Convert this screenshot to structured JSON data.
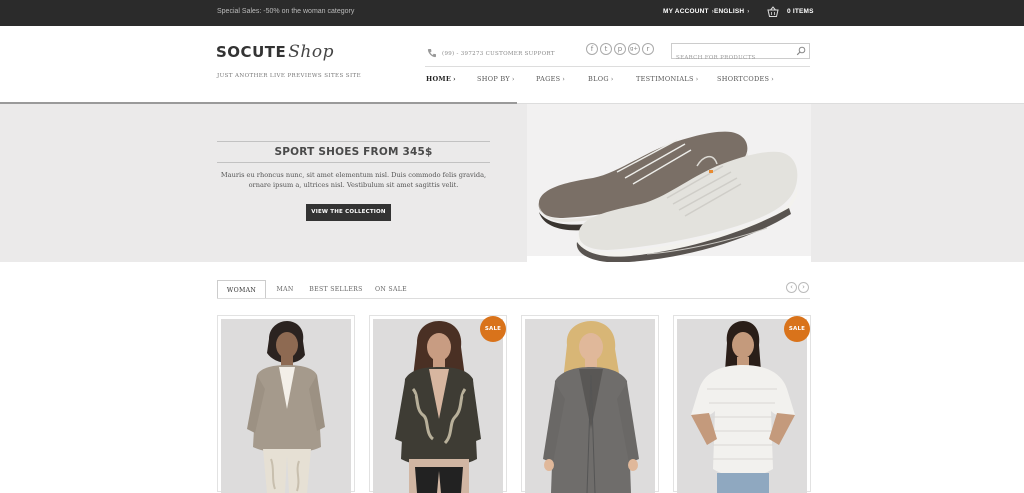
{
  "topbar": {
    "promo": "Special Sales: -50% on the woman category",
    "my_account": "MY ACCOUNT",
    "language": "ENGLISH",
    "cart_count": "0 ITEMS",
    "cart_icon": "shopping-basket-icon"
  },
  "header": {
    "logo_main": "SOCUTE",
    "logo_script": "Shop",
    "tagline": "JUST ANOTHER LIVE PREVIEWS SITES SITE",
    "phone": "(99) - 397273 CUSTOMER SUPPORT",
    "social": [
      {
        "icon": "facebook-icon",
        "glyph": "f"
      },
      {
        "icon": "twitter-icon",
        "glyph": "t"
      },
      {
        "icon": "pinterest-icon",
        "glyph": "p"
      },
      {
        "icon": "google-plus-icon",
        "glyph": "g+"
      },
      {
        "icon": "rss-icon",
        "glyph": "r"
      }
    ],
    "search_placeholder": "SEARCH FOR PRODUCTS"
  },
  "nav": [
    {
      "label": "HOME",
      "active": true
    },
    {
      "label": "SHOP BY",
      "active": false
    },
    {
      "label": "PAGES",
      "active": false
    },
    {
      "label": "BLOG",
      "active": false
    },
    {
      "label": "TESTIMONIALS",
      "active": false
    },
    {
      "label": "SHORTCODES",
      "active": false
    }
  ],
  "hero": {
    "title": "SPORT SHOES FROM 345$",
    "text": "Mauris eu rhoncus nunc, sit amet elementum nisl. Duis commodo felis gravida, ornare ipsum a, ultrices nisl. Vestibulum sit amet sagittis velit.",
    "button": "VIEW THE COLLECTION"
  },
  "tabs": [
    "WOMAN",
    "MAN",
    "BEST SELLERS",
    "ON SALE"
  ],
  "active_tab": "WOMAN",
  "products": [
    {
      "image": "woman in beige blazer",
      "sale": ""
    },
    {
      "image": "woman in patterned cardigan",
      "sale": "SALE"
    },
    {
      "image": "woman in grey coat",
      "sale": ""
    },
    {
      "image": "woman in white knit top",
      "sale": "SALE"
    }
  ],
  "colors": {
    "accent": "#d9731b",
    "topbar": "#2b2b2b",
    "hero_bg": "#ebeaea"
  }
}
